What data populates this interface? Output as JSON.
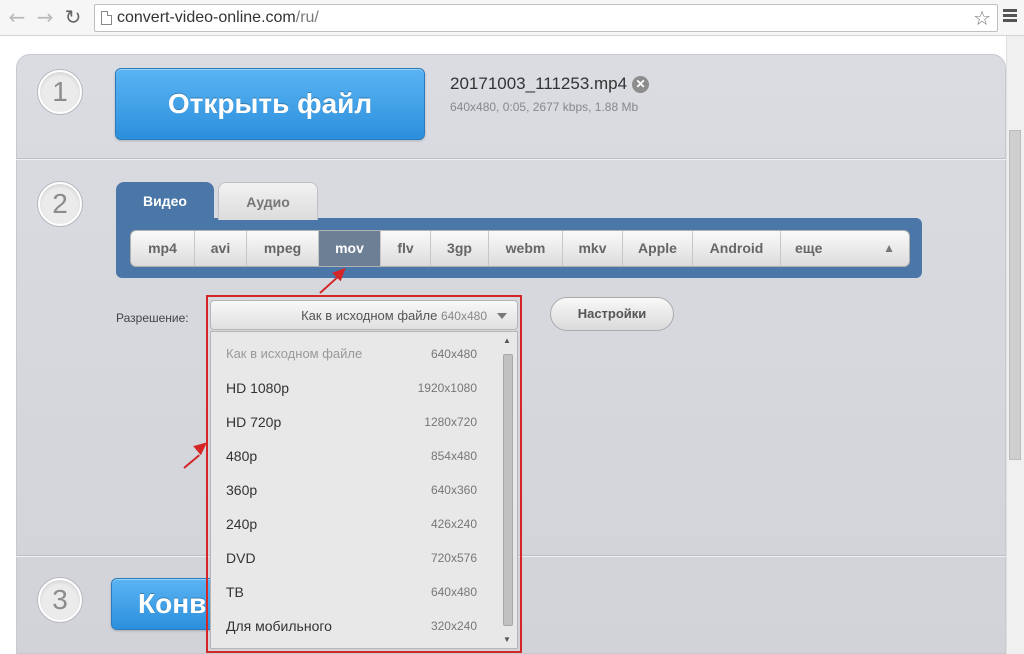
{
  "browser": {
    "url_host": "convert-video-online.com",
    "url_path": "/ru/"
  },
  "steps": {
    "one": "1",
    "two": "2",
    "three": "3"
  },
  "open_button": "Открыть файл",
  "file": {
    "name": "20171003_111253.mp4",
    "meta": "640x480, 0:05, 2677 kbps, 1.88 Mb"
  },
  "tabs": [
    "Видео",
    "Аудио"
  ],
  "formats": [
    "mp4",
    "avi",
    "mpeg",
    "mov",
    "flv",
    "3gp",
    "webm",
    "mkv",
    "Apple",
    "Android",
    "еще"
  ],
  "active_format": "mov",
  "resolution": {
    "label": "Разрешение:",
    "selected_name": "Как в исходном файле",
    "selected_size": "640x480"
  },
  "settings_button": "Настройки",
  "resolution_options": [
    {
      "name": "Как в исходном файле",
      "size": "640x480"
    },
    {
      "name": "HD 1080p",
      "size": "1920x1080"
    },
    {
      "name": "HD 720p",
      "size": "1280x720"
    },
    {
      "name": "480p",
      "size": "854x480"
    },
    {
      "name": "360p",
      "size": "640x360"
    },
    {
      "name": "240p",
      "size": "426x240"
    },
    {
      "name": "DVD",
      "size": "720x576"
    },
    {
      "name": "ТВ",
      "size": "640x480"
    },
    {
      "name": "Для мобильного",
      "size": "320x240"
    }
  ],
  "convert_button_partial": "Конв",
  "colors": {
    "accent_blue": "#2c8fdc",
    "tab_blue": "#4a76a8",
    "annotation_red": "#d42626"
  }
}
